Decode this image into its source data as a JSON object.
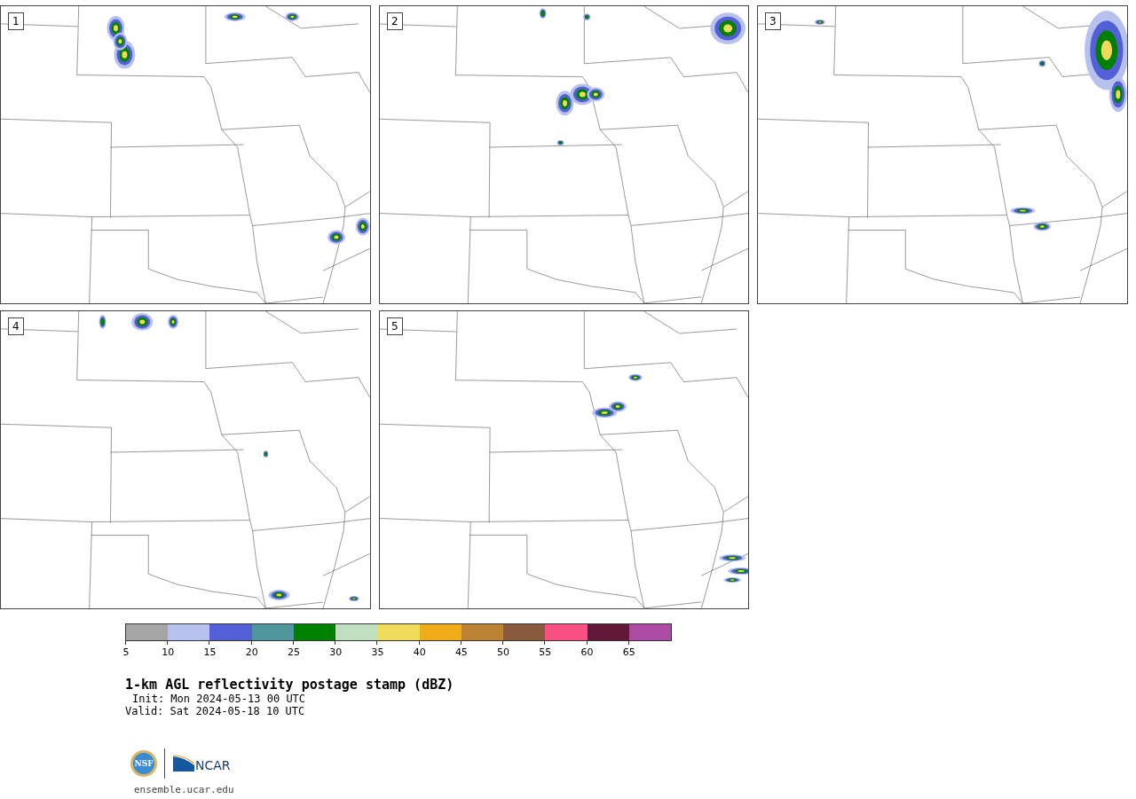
{
  "panels": [
    {
      "label": "1"
    },
    {
      "label": "2"
    },
    {
      "label": "3"
    },
    {
      "label": "4"
    },
    {
      "label": "5"
    }
  ],
  "colorbar": {
    "segments": [
      {
        "color": "#a5a5a5"
      },
      {
        "color": "#b6c1ee"
      },
      {
        "color": "#525fd6"
      },
      {
        "color": "#4f979d"
      },
      {
        "color": "#008000"
      },
      {
        "color": "#bfdfbf"
      },
      {
        "color": "#f0da5a"
      },
      {
        "color": "#f0ad19"
      },
      {
        "color": "#bb8331"
      },
      {
        "color": "#8a5a3c"
      },
      {
        "color": "#f65182"
      },
      {
        "color": "#611937"
      },
      {
        "color": "#ad4ba4"
      }
    ],
    "ticks": [
      "5",
      "10",
      "15",
      "20",
      "25",
      "30",
      "35",
      "40",
      "45",
      "50",
      "55",
      "60",
      "65"
    ]
  },
  "title": "1-km AGL reflectivity postage stamp (dBZ)",
  "init": "Init: Mon 2024-05-13 00 UTC",
  "valid": "Valid: Sat 2024-05-18 10 UTC",
  "logos": {
    "nsf": "NSF",
    "ncar": "NCAR"
  },
  "url": "ensemble.ucar.edu"
}
